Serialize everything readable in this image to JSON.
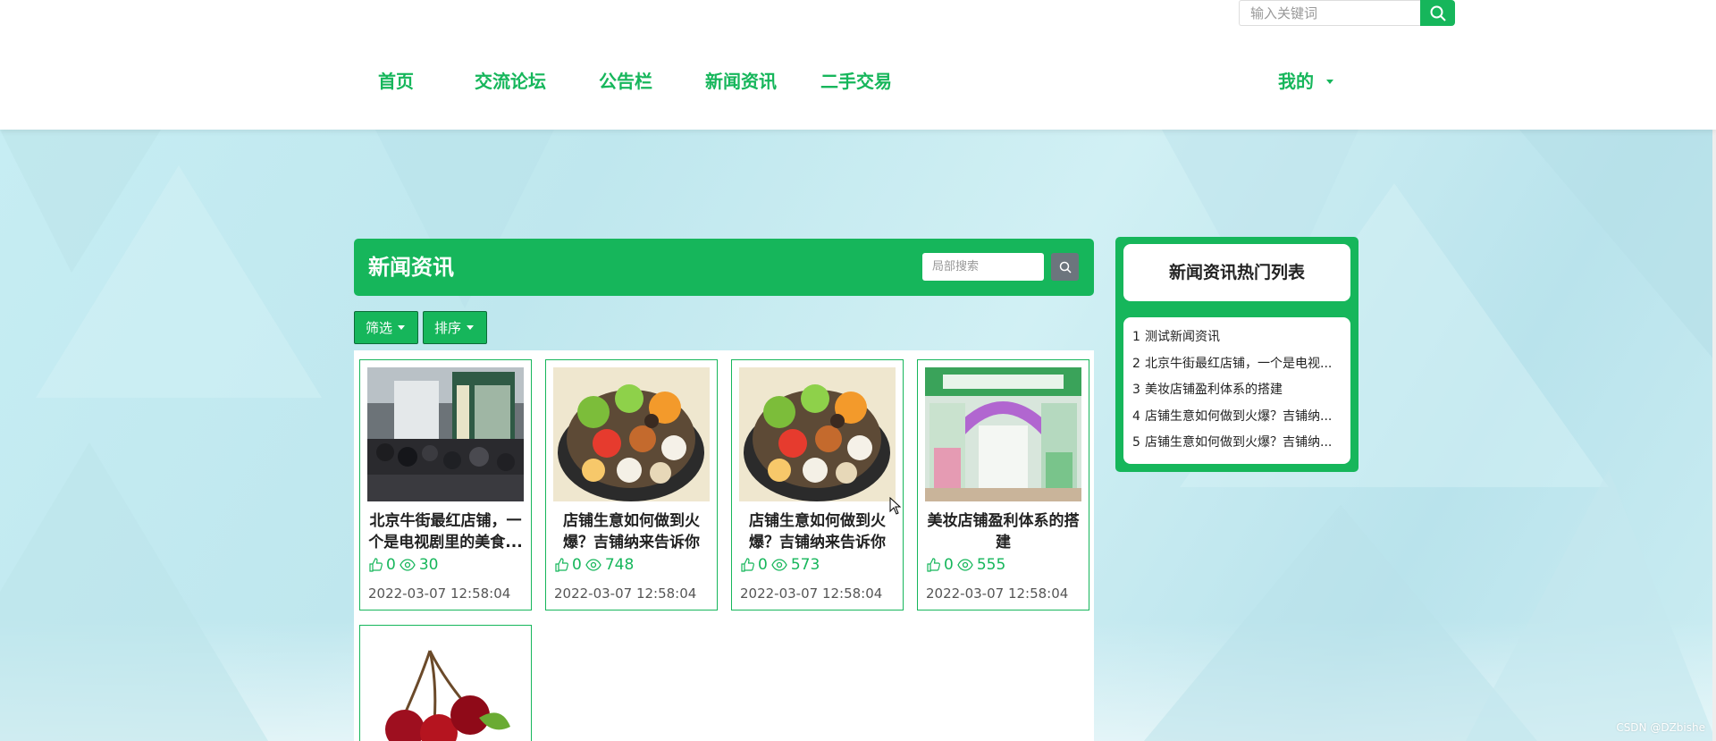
{
  "colors": {
    "accent": "#16b65b",
    "header_bg": "#ffffff",
    "page_bg": "#c9ecf1",
    "grey_button": "#6c757d"
  },
  "header": {
    "search_placeholder": "输入关键词",
    "nav": [
      {
        "label": "首页"
      },
      {
        "label": "交流论坛"
      },
      {
        "label": "公告栏"
      },
      {
        "label": "新闻资讯"
      },
      {
        "label": "二手交易"
      }
    ],
    "mine_label": "我的"
  },
  "main": {
    "title": "新闻资讯",
    "local_search_placeholder": "局部搜索",
    "filter_label": "筛选",
    "sort_label": "排序",
    "cards": [
      {
        "title": "北京牛街最红店铺，一个是电视剧里的美食...",
        "likes": "0",
        "views": "30",
        "date": "2022-03-07 12:58:04",
        "image": "street-photo"
      },
      {
        "title": "店铺生意如何做到火爆？吉铺纳来告诉你",
        "likes": "0",
        "views": "748",
        "date": "2022-03-07 12:58:04",
        "image": "food-platter-photo"
      },
      {
        "title": "店铺生意如何做到火爆？吉铺纳来告诉你",
        "likes": "0",
        "views": "573",
        "date": "2022-03-07 12:58:04",
        "image": "food-platter-photo"
      },
      {
        "title": "美妆店铺盈利体系的搭建",
        "likes": "0",
        "views": "555",
        "date": "2022-03-07 12:58:04",
        "image": "shop-front-photo"
      },
      {
        "image": "cherry-photo"
      }
    ]
  },
  "hot": {
    "title": "新闻资讯热门列表",
    "items": [
      {
        "num": "1",
        "text": "测试新闻资讯"
      },
      {
        "num": "2",
        "text": "北京牛街最红店铺，一个是电视..."
      },
      {
        "num": "3",
        "text": "美妆店铺盈利体系的搭建"
      },
      {
        "num": "4",
        "text": "店铺生意如何做到火爆？吉铺纳..."
      },
      {
        "num": "5",
        "text": "店铺生意如何做到火爆？吉铺纳..."
      }
    ]
  },
  "watermark": "CSDN @DZbishe"
}
